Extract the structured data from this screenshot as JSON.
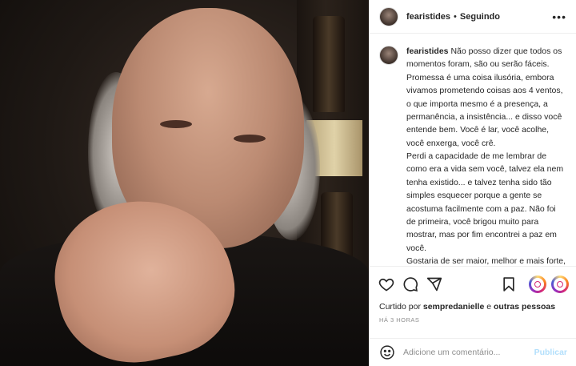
{
  "post": {
    "username": "fearistides",
    "separator": "•",
    "follow_status": "Seguindo",
    "more_label": "•••"
  },
  "caption": {
    "username": "fearistides",
    "paragraphs": [
      " Não posso dizer que todos os momentos foram, são ou serão fáceis. Promessa é uma coisa ilusória, embora vivamos prometendo coisas aos 4 ventos, o que importa mesmo é a presença, a permanência, a insistência... e disso você entende bem. Você é lar, você acolhe, você enxerga, você crê.",
      "Perdi a capacidade de me lembrar de como era a vida sem você, talvez ela nem tenha existido... e talvez tenha sido tão simples esquecer porque a gente se acostuma facilmente com a paz. Não foi de primeira, você brigou muito para mostrar, mas por fim encontrei a paz em você.",
      "Gostaria de ser maior, melhor e mais forte, te proteger de tudo, brigar por você e dominar todas as áreas do que"
    ]
  },
  "actions": {
    "icons": [
      "heart-icon",
      "comment-icon",
      "share-icon",
      "bookmark-icon",
      "instagram-badge-icon"
    ]
  },
  "likes": {
    "prefix": "Curtido por ",
    "user": "sempredanielle",
    "middle": " e ",
    "others": "outras pessoas"
  },
  "timestamp": "HÁ 3 HORAS",
  "comment": {
    "placeholder": "Adicione um comentário...",
    "publish_label": "Publicar"
  },
  "colors": {
    "text": "#262626",
    "muted": "#8e8e8e",
    "publish_disabled": "#b2dffc",
    "divider": "#efefef"
  }
}
